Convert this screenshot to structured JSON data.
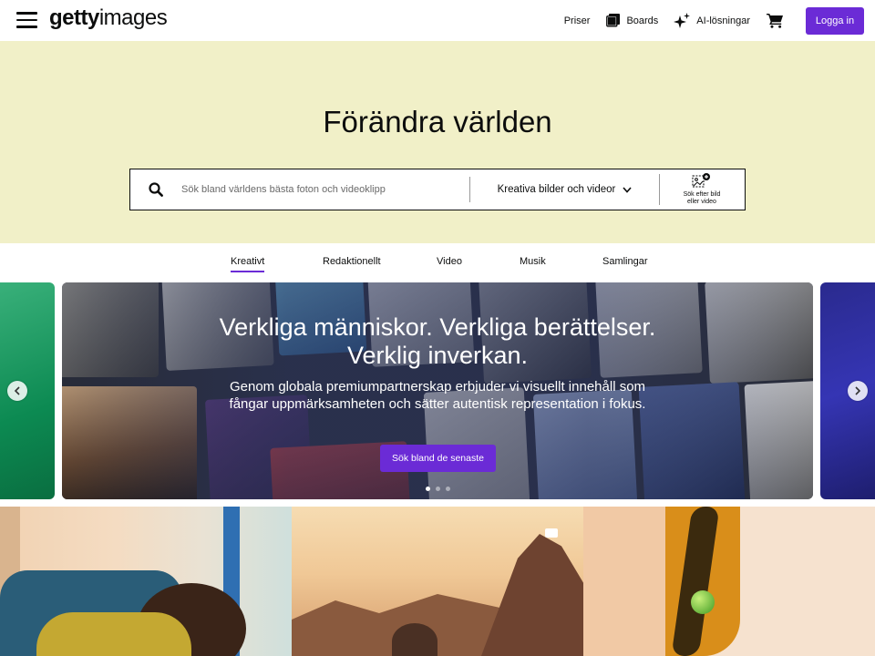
{
  "header": {
    "logo_bold": "getty",
    "logo_light": "images",
    "nav": {
      "pricing": "Priser",
      "boards": "Boards",
      "ai": "AI-lösningar"
    },
    "login": "Logga in"
  },
  "hero": {
    "title": "Förändra världen",
    "search": {
      "placeholder": "Sök bland världens bästa foton och videoklipp",
      "type": "Kreativa bilder och videor",
      "visual_search_line1": "Sök efter bild",
      "visual_search_line2": "eller video"
    }
  },
  "tabs": [
    {
      "label": "Kreativt",
      "active": true
    },
    {
      "label": "Redaktionellt",
      "active": false
    },
    {
      "label": "Video",
      "active": false
    },
    {
      "label": "Musik",
      "active": false
    },
    {
      "label": "Samlingar",
      "active": false
    }
  ],
  "carousel": {
    "headline_line1": "Verkliga människor. Verkliga berättelser.",
    "headline_line2": "Verklig inverkan.",
    "body": "Genom globala premiumpartnerskap erbjuder vi visuellt innehåll som fångar uppmärksamheten och sätter autentisk representation i fokus.",
    "cta": "Sök bland de senaste",
    "slide_count": 3,
    "active_slide": 1
  },
  "colors": {
    "brand_purple": "#6b2bd6",
    "hero_bg": "#f1f0c8",
    "text": "#0c0d0d"
  },
  "icons": {
    "menu": "hamburger-icon",
    "boards": "boards-icon",
    "ai": "sparkle-icon",
    "cart": "cart-icon",
    "search": "search-icon",
    "chevron": "chevron-down-icon",
    "visual_search": "image-search-icon",
    "prev": "chevron-left-icon",
    "next": "chevron-right-icon"
  }
}
